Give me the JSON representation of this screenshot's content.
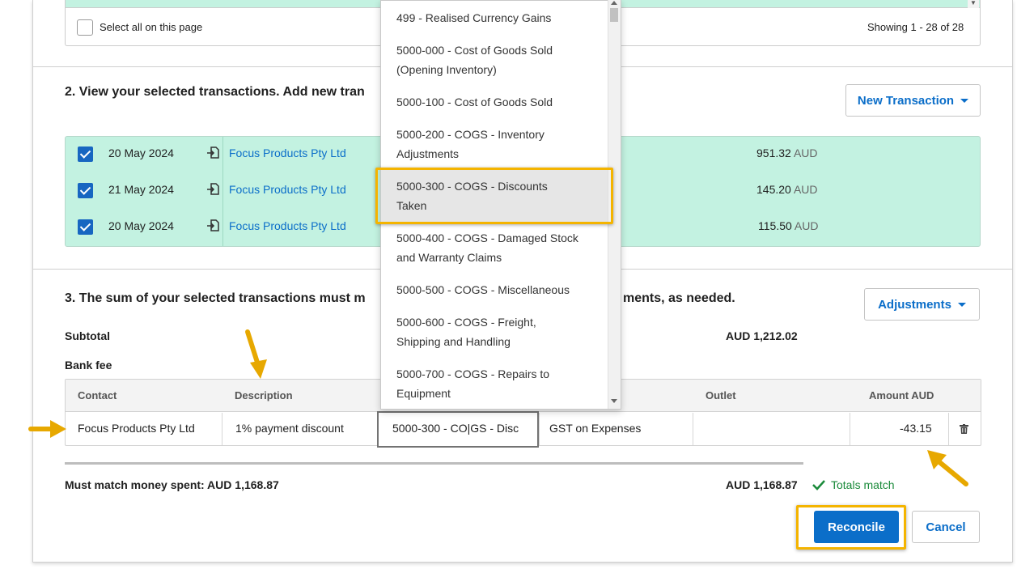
{
  "top_section": {
    "select_all_label": "Select all on this page",
    "showing_text": "Showing 1 - 28 of 28"
  },
  "section2": {
    "heading": "2. View your selected transactions. Add new tran",
    "new_transaction_label": "New Transaction",
    "rows": [
      {
        "date": "20 May 2024",
        "contact": "Focus Products Pty Ltd",
        "amount": "951.32",
        "currency": "AUD"
      },
      {
        "date": "21 May 2024",
        "contact": "Focus Products Pty Ltd",
        "amount": "145.20",
        "currency": "AUD"
      },
      {
        "date": "20 May 2024",
        "contact": "Focus Products Pty Ltd",
        "amount": "115.50",
        "currency": "AUD"
      }
    ]
  },
  "section3": {
    "heading_left": "3. The sum of your selected transactions must m",
    "heading_right": "ments, as needed.",
    "adjustments_label": "Adjustments",
    "subtotal_label": "Subtotal",
    "subtotal_value": "AUD 1,212.02",
    "bank_fee_label": "Bank fee",
    "table": {
      "headers": {
        "contact": "Contact",
        "description": "Description",
        "outlet": "Outlet",
        "amount": "Amount AUD"
      },
      "row": {
        "contact": "Focus Products Pty Ltd",
        "description": "1% payment discount",
        "account": "5000-300 - CO|GS - Disc",
        "tax": "GST on Expenses",
        "outlet": "",
        "amount": "-43.15"
      }
    },
    "must_match_label": "Must match money spent: AUD 1,168.87",
    "total_value": "AUD 1,168.87",
    "totals_match_label": "Totals match",
    "reconcile_label": "Reconcile",
    "cancel_label": "Cancel"
  },
  "dropdown": {
    "items": [
      {
        "line1": "499 - Realised Currency Gains",
        "line2": ""
      },
      {
        "line1": "5000-000 - Cost of Goods Sold",
        "line2": "(Opening Inventory)"
      },
      {
        "line1": "5000-100 - Cost of Goods Sold",
        "line2": ""
      },
      {
        "line1": "5000-200 - COGS - Inventory",
        "line2": "Adjustments"
      },
      {
        "line1": "5000-300 - COGS - Discounts",
        "line2": "Taken"
      },
      {
        "line1": "5000-400 - COGS - Damaged Stock",
        "line2": "and Warranty Claims"
      },
      {
        "line1": "5000-500 - COGS - Miscellaneous",
        "line2": ""
      },
      {
        "line1": "5000-600 - COGS - Freight,",
        "line2": "Shipping and Handling"
      },
      {
        "line1": "5000-700 - COGS - Repairs to",
        "line2": "Equipment"
      }
    ],
    "selected_index": 4
  },
  "colors": {
    "accent_blue": "#0b6ec9",
    "highlight_yellow": "#f4b400",
    "row_green": "#c3f2e1",
    "success_green": "#1a8a3a"
  }
}
